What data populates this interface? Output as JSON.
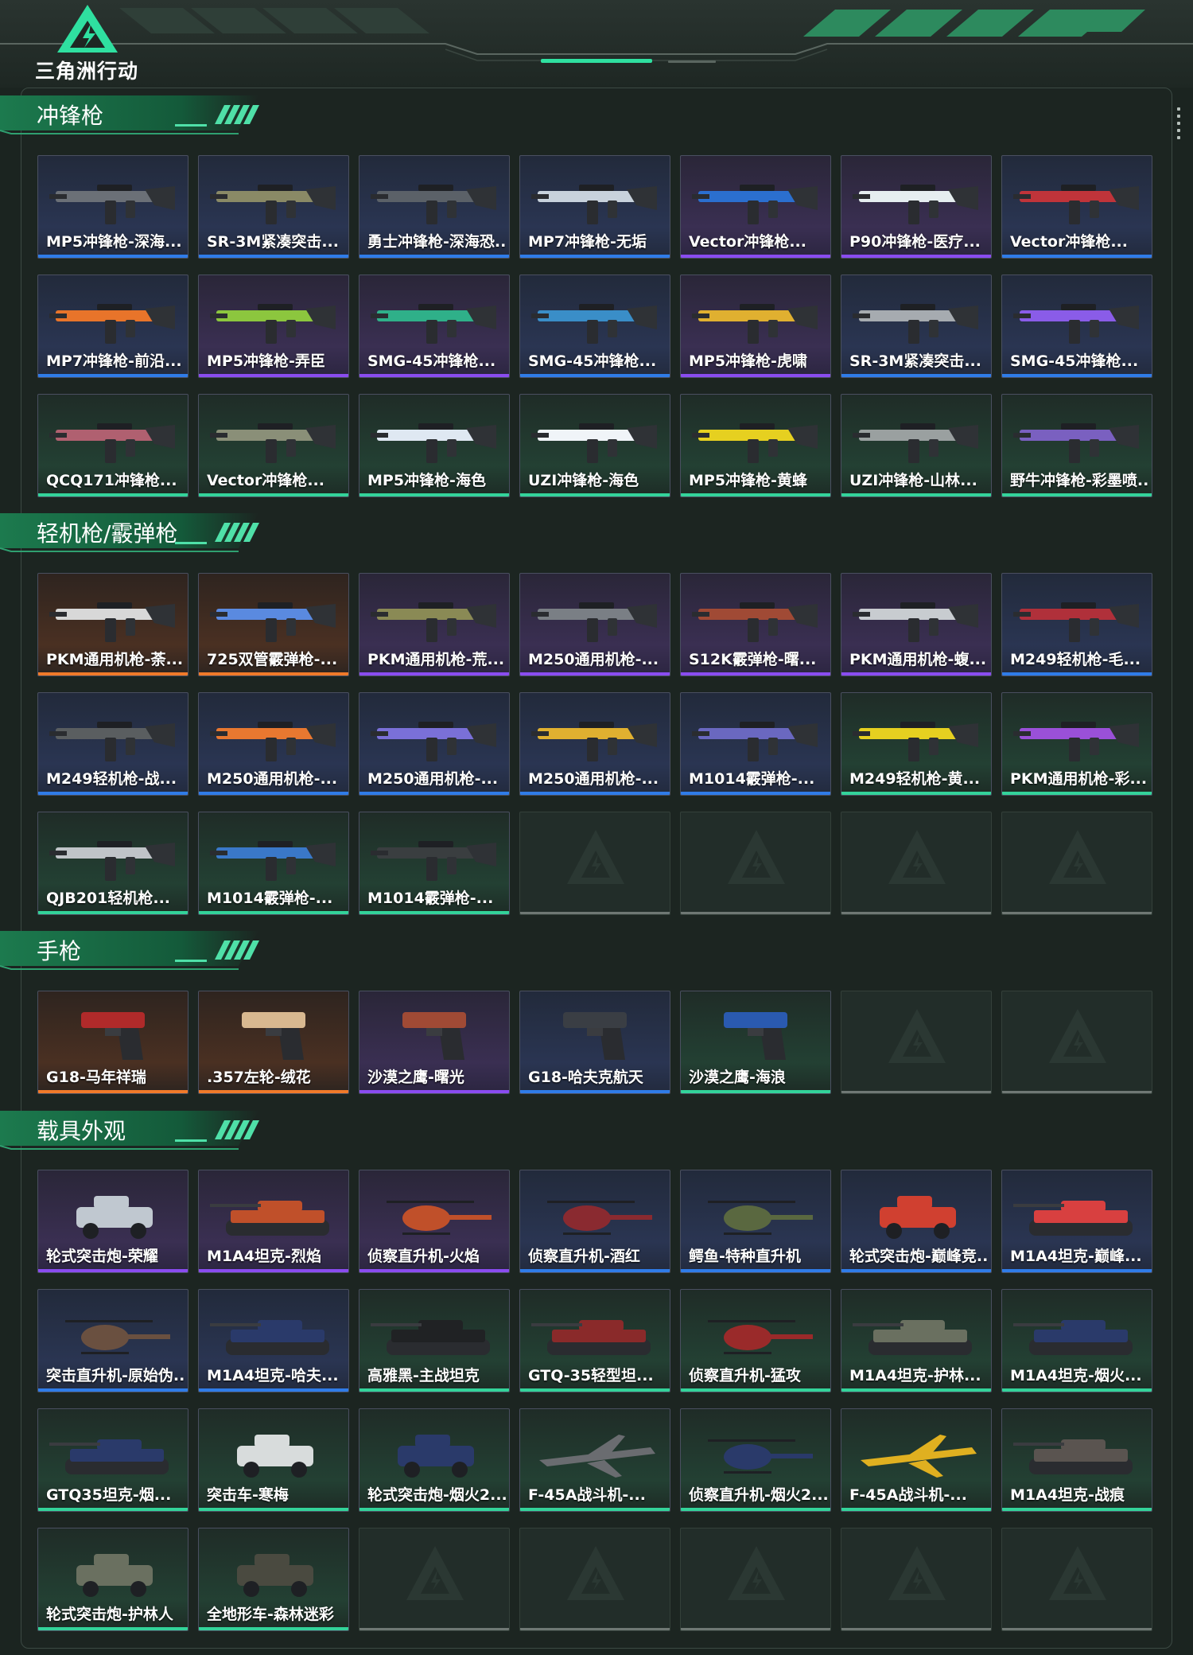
{
  "brand": {
    "title": "三角洲行动",
    "accent": "#2fe0a0"
  },
  "sections": [
    {
      "id": "smg",
      "title": "冲锋枪",
      "items": [
        {
          "label": "MP5冲锋枪-深海...",
          "rarity": "blue",
          "kind": "gun",
          "color": "#6b7077"
        },
        {
          "label": "SR-3M紧凑突击...",
          "rarity": "blue",
          "kind": "gun",
          "color": "#8a8a66"
        },
        {
          "label": "勇士冲锋枪-深海恐...",
          "rarity": "blue",
          "kind": "gun",
          "color": "#5b6168"
        },
        {
          "label": "MP7冲锋枪-无垢",
          "rarity": "blue",
          "kind": "gun",
          "color": "#c8d2dc"
        },
        {
          "label": "Vector冲锋枪...",
          "rarity": "purple",
          "kind": "gun",
          "color": "#2b6fcf"
        },
        {
          "label": "P90冲锋枪-医疗...",
          "rarity": "purple",
          "kind": "gun",
          "color": "#e6eef0"
        },
        {
          "label": "Vector冲锋枪...",
          "rarity": "blue",
          "kind": "gun",
          "color": "#c0343a"
        },
        {
          "label": "MP7冲锋枪-前沿...",
          "rarity": "blue",
          "kind": "gun",
          "color": "#e8742a"
        },
        {
          "label": "MP5冲锋枪-弄臣",
          "rarity": "purple",
          "kind": "gun",
          "color": "#8cc63e"
        },
        {
          "label": "SMG-45冲锋枪...",
          "rarity": "purple",
          "kind": "gun",
          "color": "#2fb089"
        },
        {
          "label": "SMG-45冲锋枪...",
          "rarity": "blue",
          "kind": "gun",
          "color": "#3a8ec8"
        },
        {
          "label": "MP5冲锋枪-虎啸",
          "rarity": "purple",
          "kind": "gun",
          "color": "#e0b030"
        },
        {
          "label": "SR-3M紧凑突击...",
          "rarity": "blue",
          "kind": "gun",
          "color": "#a6abb0"
        },
        {
          "label": "SMG-45冲锋枪...",
          "rarity": "blue",
          "kind": "gun",
          "color": "#8a5ce8"
        },
        {
          "label": "QCQ171冲锋枪...",
          "rarity": "green",
          "kind": "gun",
          "color": "#b06070"
        },
        {
          "label": "Vector冲锋枪...",
          "rarity": "green",
          "kind": "gun",
          "color": "#8a8f78"
        },
        {
          "label": "MP5冲锋枪-海色",
          "rarity": "green",
          "kind": "gun",
          "color": "#dfe8f2"
        },
        {
          "label": "UZI冲锋枪-海色",
          "rarity": "green",
          "kind": "gun",
          "color": "#f0f4f8"
        },
        {
          "label": "MP5冲锋枪-黄蜂",
          "rarity": "green",
          "kind": "gun",
          "color": "#e6d020"
        },
        {
          "label": "UZI冲锋枪-山林...",
          "rarity": "green",
          "kind": "gun",
          "color": "#9aa0a0"
        },
        {
          "label": "野牛冲锋枪-彩墨喷...",
          "rarity": "green",
          "kind": "gun",
          "color": "#7a60c0"
        }
      ]
    },
    {
      "id": "lmg",
      "title": "轻机枪/霰弹枪",
      "items": [
        {
          "label": "PKM通用机枪-荼...",
          "rarity": "orange",
          "kind": "gun",
          "color": "#d8d8d8"
        },
        {
          "label": "725双管霰弹枪-...",
          "rarity": "orange",
          "kind": "gun",
          "color": "#5a8ae0"
        },
        {
          "label": "PKM通用机枪-荒...",
          "rarity": "purple",
          "kind": "gun",
          "color": "#8a8a55"
        },
        {
          "label": "M250通用机枪-...",
          "rarity": "purple",
          "kind": "gun",
          "color": "#7a7f85"
        },
        {
          "label": "S12K霰弹枪-曙...",
          "rarity": "purple",
          "kind": "gun",
          "color": "#a04a35"
        },
        {
          "label": "PKM通用机枪-蝮...",
          "rarity": "purple",
          "kind": "gun",
          "color": "#c8ccd0"
        },
        {
          "label": "M249轻机枪-毛...",
          "rarity": "blue",
          "kind": "gun",
          "color": "#b0303a"
        },
        {
          "label": "M249轻机枪-战...",
          "rarity": "blue",
          "kind": "gun",
          "color": "#5a5e60"
        },
        {
          "label": "M250通用机枪-...",
          "rarity": "blue",
          "kind": "gun",
          "color": "#e87830"
        },
        {
          "label": "M250通用机枪-...",
          "rarity": "blue",
          "kind": "gun",
          "color": "#7a70d8"
        },
        {
          "label": "M250通用机枪-...",
          "rarity": "blue",
          "kind": "gun",
          "color": "#e0b030"
        },
        {
          "label": "M1014霰弹枪-...",
          "rarity": "blue",
          "kind": "gun",
          "color": "#6a68c0"
        },
        {
          "label": "M249轻机枪-黄...",
          "rarity": "green",
          "kind": "gun",
          "color": "#e6d020"
        },
        {
          "label": "PKM通用机枪-彩...",
          "rarity": "green",
          "kind": "gun",
          "color": "#9a50d8"
        },
        {
          "label": "QJB201轻机枪...",
          "rarity": "green",
          "kind": "gun",
          "color": "#c0c4c8"
        },
        {
          "label": "M1014霰弹枪-...",
          "rarity": "green",
          "kind": "gun",
          "color": "#3a78c8"
        },
        {
          "label": "M1014霰弹枪-...",
          "rarity": "green",
          "kind": "gun",
          "color": "#3a3e40"
        },
        {
          "label": "",
          "rarity": "empty",
          "kind": "empty"
        },
        {
          "label": "",
          "rarity": "empty",
          "kind": "empty"
        },
        {
          "label": "",
          "rarity": "empty",
          "kind": "empty"
        },
        {
          "label": "",
          "rarity": "empty",
          "kind": "empty"
        }
      ]
    },
    {
      "id": "pistol",
      "title": "手枪",
      "items": [
        {
          "label": "G18-马年祥瑞",
          "rarity": "orange",
          "kind": "pistol",
          "color": "#b02a2a"
        },
        {
          "label": ".357左轮-绒花",
          "rarity": "orange",
          "kind": "pistol",
          "color": "#d8b890"
        },
        {
          "label": "沙漠之鹰-曙光",
          "rarity": "purple",
          "kind": "pistol",
          "color": "#a04a35"
        },
        {
          "label": "G18-哈夫克航天",
          "rarity": "blue",
          "kind": "pistol",
          "color": "#3a3e44"
        },
        {
          "label": "沙漠之鹰-海浪",
          "rarity": "green",
          "kind": "pistol",
          "color": "#2a5ab0"
        },
        {
          "label": "",
          "rarity": "empty",
          "kind": "empty"
        },
        {
          "label": "",
          "rarity": "empty",
          "kind": "empty"
        }
      ]
    },
    {
      "id": "vehicle",
      "title": "载具外观",
      "items": [
        {
          "label": "轮式突击炮-荣耀",
          "rarity": "purple",
          "kind": "car",
          "color": "#c0c8d0"
        },
        {
          "label": "M1A4坦克-烈焰",
          "rarity": "purple",
          "kind": "tank",
          "color": "#c0502a"
        },
        {
          "label": "侦察直升机-火焰",
          "rarity": "purple",
          "kind": "heli",
          "color": "#c0502a"
        },
        {
          "label": "侦察直升机-酒红",
          "rarity": "blue",
          "kind": "heli",
          "color": "#8a2a30"
        },
        {
          "label": "鳄鱼-特种直升机",
          "rarity": "blue",
          "kind": "heli",
          "color": "#5a6840"
        },
        {
          "label": "轮式突击炮-巅峰竞...",
          "rarity": "blue",
          "kind": "car",
          "color": "#d04030"
        },
        {
          "label": "M1A4坦克-巅峰...",
          "rarity": "blue",
          "kind": "tank",
          "color": "#d84040"
        },
        {
          "label": "突击直升机-原始伪...",
          "rarity": "blue",
          "kind": "heli",
          "color": "#6a5040"
        },
        {
          "label": "M1A4坦克-哈夫...",
          "rarity": "blue",
          "kind": "tank",
          "color": "#2a3a6a"
        },
        {
          "label": "高雅黑-主战坦克",
          "rarity": "green",
          "kind": "tank",
          "color": "#202224"
        },
        {
          "label": "GTQ-35轻型坦...",
          "rarity": "green",
          "kind": "tank",
          "color": "#8a2a2a"
        },
        {
          "label": "侦察直升机-猛攻",
          "rarity": "green",
          "kind": "heli",
          "color": "#9a2a2a"
        },
        {
          "label": "M1A4坦克-护林...",
          "rarity": "green",
          "kind": "tank",
          "color": "#6a7060"
        },
        {
          "label": "M1A4坦克-烟火...",
          "rarity": "green",
          "kind": "tank",
          "color": "#2a3a6a"
        },
        {
          "label": "GTQ35坦克-烟...",
          "rarity": "green",
          "kind": "tank",
          "color": "#2a3a6a"
        },
        {
          "label": "突击车-寒梅",
          "rarity": "green",
          "kind": "car",
          "color": "#d8dcdc"
        },
        {
          "label": "轮式突击炮-烟火2...",
          "rarity": "green",
          "kind": "car",
          "color": "#2a3a6a"
        },
        {
          "label": "F-45A战斗机-...",
          "rarity": "green",
          "kind": "jet",
          "color": "#6a6c70"
        },
        {
          "label": "侦察直升机-烟火2...",
          "rarity": "green",
          "kind": "heli",
          "color": "#2a3a6a"
        },
        {
          "label": "F-45A战斗机-...",
          "rarity": "green",
          "kind": "jet",
          "color": "#e0b020"
        },
        {
          "label": "M1A4坦克-战痕",
          "rarity": "green",
          "kind": "tank",
          "color": "#5a5450"
        },
        {
          "label": "轮式突击炮-护林人",
          "rarity": "green",
          "kind": "car",
          "color": "#6a7060"
        },
        {
          "label": "全地形车-森林迷彩",
          "rarity": "green",
          "kind": "atv",
          "color": "#4a4a40"
        },
        {
          "label": "",
          "rarity": "empty",
          "kind": "empty"
        },
        {
          "label": "",
          "rarity": "empty",
          "kind": "empty"
        },
        {
          "label": "",
          "rarity": "empty",
          "kind": "empty"
        },
        {
          "label": "",
          "rarity": "empty",
          "kind": "empty"
        },
        {
          "label": "",
          "rarity": "empty",
          "kind": "empty"
        }
      ]
    }
  ]
}
